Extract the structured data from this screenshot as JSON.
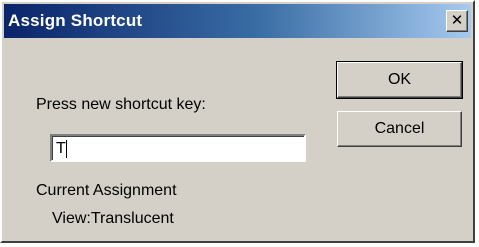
{
  "dialog": {
    "title": "Assign Shortcut",
    "close_glyph": "✕",
    "prompt_label": "Press new shortcut key:",
    "shortcut_value": "T",
    "ok_label": "OK",
    "cancel_label": "Cancel",
    "current_assignment_label": "Current Assignment",
    "current_assignment_value": "View:Translucent"
  },
  "icons": {
    "close": "close-icon"
  },
  "colors": {
    "face": "#d4d0c8",
    "title_start": "#0a246a",
    "title_end": "#a6caf0"
  }
}
